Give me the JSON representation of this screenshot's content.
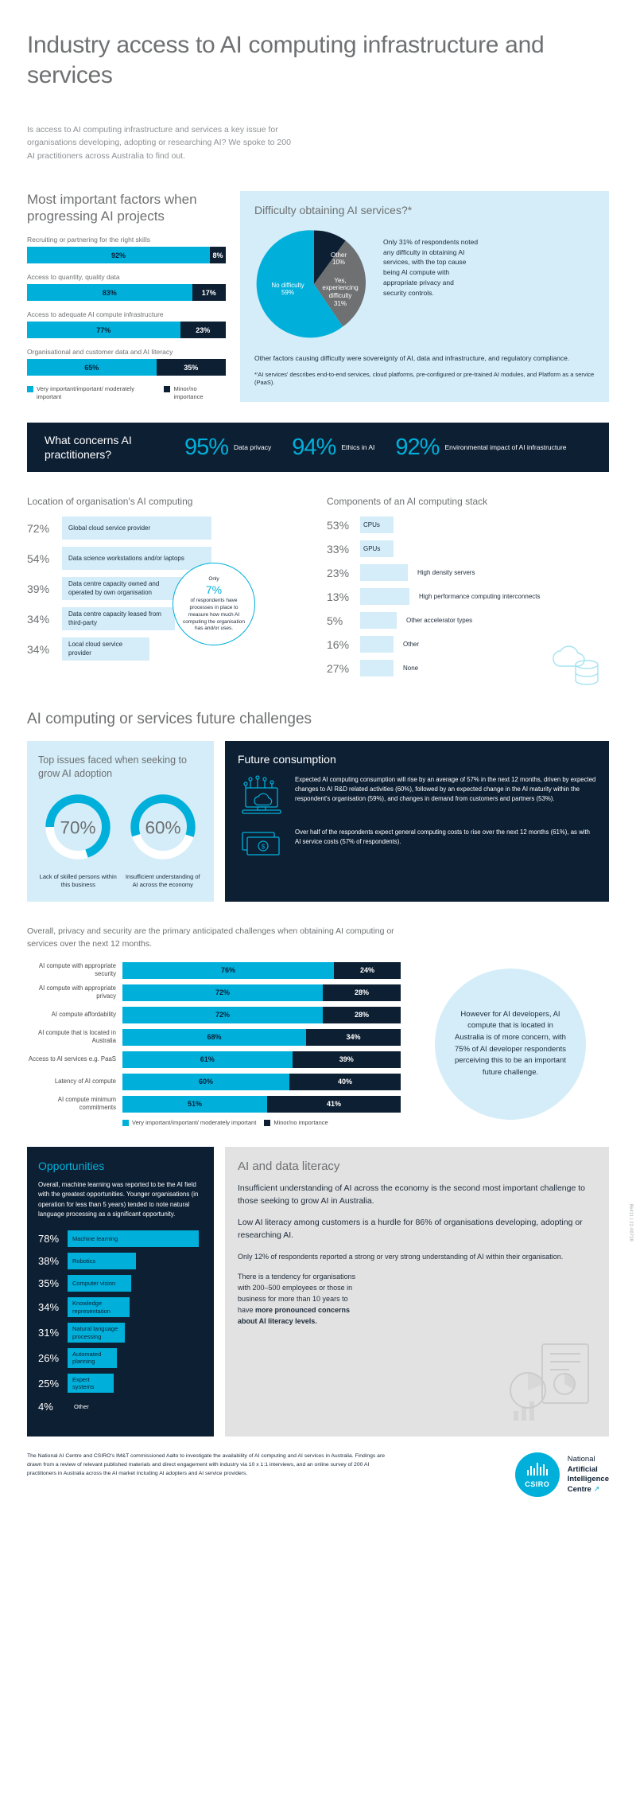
{
  "header": {
    "title": "Industry access to AI computing infrastructure and services",
    "intro": "Is access to AI computing infrastructure and services a key issue for organisations developing, adopting or researching AI? We spoke to 200 AI practitioners across Australia to find out."
  },
  "factors": {
    "heading": "Most important factors when progressing AI projects",
    "legend": {
      "primary": "Very important/important/ moderately important",
      "secondary": "Minor/no importance"
    },
    "items": [
      {
        "label": "Recruiting or partnering for the right skills",
        "primary": 92,
        "secondary": 8,
        "primary_text": "92%",
        "secondary_text": "8%"
      },
      {
        "label": "Access to quantity, quality data",
        "primary": 83,
        "secondary": 17,
        "primary_text": "83%",
        "secondary_text": "17%"
      },
      {
        "label": "Access to adequate AI compute infrastructure",
        "primary": 77,
        "secondary": 23,
        "primary_text": "77%",
        "secondary_text": "23%"
      },
      {
        "label": "Organisational and customer data and AI literacy",
        "primary": 65,
        "secondary": 35,
        "primary_text": "65%",
        "secondary_text": "35%"
      }
    ]
  },
  "difficulty": {
    "heading": "Difficulty obtaining AI services?*",
    "note": "Only 31% of respondents noted any difficulty in obtaining AI services, with the top cause being AI compute with appropriate privacy and security controls.",
    "footnote": "Other factors causing difficulty were sovereignty of AI, data and infrastructure, and regulatory compliance.",
    "asterisk": "*'AI services' describes end-to-end services, cloud platforms, pre-configured or pre-trained AI modules, and Platform as a service (PaaS).",
    "slices": [
      {
        "label": "No difficulty",
        "value": 59,
        "value_text": "59%",
        "color": "#00b0da"
      },
      {
        "label": "Other",
        "value": 10,
        "value_text": "10%",
        "color": "#0d1f33"
      },
      {
        "label": "Yes, experiencing difficulty",
        "value": 31,
        "value_text": "31%",
        "color": "#6e7072"
      }
    ]
  },
  "concerns": {
    "question": "What concerns AI practitioners?",
    "stats": [
      {
        "value": "95%",
        "caption": "Data privacy"
      },
      {
        "value": "94%",
        "caption": "Ethics in AI"
      },
      {
        "value": "92%",
        "caption": "Environmental impact of AI infrastructure"
      }
    ]
  },
  "location": {
    "heading": "Location of organisation's AI computing",
    "items": [
      {
        "pct": "72%",
        "value": 72,
        "label": "Global cloud service provider"
      },
      {
        "pct": "54%",
        "value": 54,
        "label": "Data science workstations and/or laptops"
      },
      {
        "pct": "39%",
        "value": 39,
        "label": "Data centre capacity owned and operated by own organisation"
      },
      {
        "pct": "34%",
        "value": 34,
        "label": "Data centre capacity leased from third-party"
      },
      {
        "pct": "34%",
        "value": 34,
        "label": "Local cloud service provider"
      }
    ],
    "callout": {
      "pre": "Only",
      "big": "7%",
      "post": "of respondents have processes in place to measure how much AI computing the organisation has and/or uses."
    }
  },
  "stack": {
    "heading": "Components of an AI computing stack",
    "items": [
      {
        "pct": "53%",
        "value": 53,
        "label": "CPUs"
      },
      {
        "pct": "33%",
        "value": 33,
        "label": "GPUs"
      },
      {
        "pct": "23%",
        "value": 23,
        "label": "High density servers"
      },
      {
        "pct": "13%",
        "value": 13,
        "label": "High performance computing interconnects"
      },
      {
        "pct": "5%",
        "value": 5,
        "label": "Other accelerator types"
      },
      {
        "pct": "16%",
        "value": 16,
        "label": "Other"
      },
      {
        "pct": "27%",
        "value": 27,
        "label": "None"
      }
    ]
  },
  "future_section": {
    "heading": "AI computing or services future challenges",
    "top_issues": {
      "heading": "Top issues faced when seeking to grow AI adoption",
      "donuts": [
        {
          "value": 70,
          "value_text": "70%",
          "caption": "Lack of skilled persons within this business"
        },
        {
          "value": 60,
          "value_text": "60%",
          "caption": "Insufficient understanding of AI across the economy"
        }
      ]
    },
    "consumption": {
      "heading": "Future consumption",
      "blocks": [
        {
          "icon": "cloud-laptop-icon",
          "text": "Expected AI computing consumption will rise by an average of 57% in the next 12 months, driven by expected changes to AI R&D related activities (60%), followed by an expected change in the AI maturity within the respondent's organisation (59%), and changes in demand from customers and partners (53%)."
        },
        {
          "icon": "money-icon",
          "text": "Over half of the respondents expect general computing costs to rise over the next 12 months (61%), as with AI service costs (57% of respondents)."
        }
      ]
    }
  },
  "privacy": {
    "lead": "Overall, privacy and security are the primary anticipated challenges when obtaining AI computing or services over the next 12 months.",
    "legend": {
      "primary": "Very important/important/ moderately important",
      "secondary": "Minor/no importance"
    },
    "items": [
      {
        "label": "AI compute with appropriate security",
        "primary": 76,
        "secondary": 24,
        "primary_text": "76%",
        "secondary_text": "24%"
      },
      {
        "label": "AI compute with appropriate privacy",
        "primary": 72,
        "secondary": 28,
        "primary_text": "72%",
        "secondary_text": "28%"
      },
      {
        "label": "AI compute affordability",
        "primary": 72,
        "secondary": 28,
        "primary_text": "72%",
        "secondary_text": "28%"
      },
      {
        "label": "AI compute that is located in Australia",
        "primary": 68,
        "secondary": 34,
        "primary_text": "68%",
        "secondary_text": "34%"
      },
      {
        "label": "Access to AI services e.g. PaaS",
        "primary": 61,
        "secondary": 39,
        "primary_text": "61%",
        "secondary_text": "39%"
      },
      {
        "label": "Latency of AI compute",
        "primary": 60,
        "secondary": 40,
        "primary_text": "60%",
        "secondary_text": "40%"
      },
      {
        "label": "AI compute minimum commitments",
        "primary": 51,
        "secondary": 41,
        "primary_text": "51%",
        "secondary_text": "41%"
      }
    ],
    "callout": "However for AI developers, AI compute that is located in Australia is of more concern, with 75% of AI developer respondents perceiving this to be an important future challenge."
  },
  "opportunities": {
    "heading": "Opportunities",
    "intro": "Overall, machine learning was reported to be the AI field with the greatest opportunities. Younger organisations (in operation for less than 5 years) tended to note natural language processing as a significant opportunity.",
    "items": [
      {
        "pct": "78%",
        "value": 78,
        "label": "Machine learning"
      },
      {
        "pct": "38%",
        "value": 38,
        "label": "Robotics"
      },
      {
        "pct": "35%",
        "value": 35,
        "label": "Computer vision"
      },
      {
        "pct": "34%",
        "value": 34,
        "label": "Knowledge representation"
      },
      {
        "pct": "31%",
        "value": 31,
        "label": "Natural language processing"
      },
      {
        "pct": "26%",
        "value": 26,
        "label": "Automated planning"
      },
      {
        "pct": "25%",
        "value": 25,
        "label": "Expert systems"
      },
      {
        "pct": "4%",
        "value": 4,
        "label": "Other"
      }
    ]
  },
  "literacy": {
    "heading": "AI and data literacy",
    "p1": "Insufficient understanding of AI across the economy is the second most important challenge to those seeking to grow AI in Australia.",
    "p2": "Low AI literacy among customers is a hurdle for 86% of organisations developing, adopting or researching AI.",
    "p3": "Only 12% of respondents reported a strong or very strong understanding of AI within their organisation.",
    "p4_a": "There is a tendency for organisations with 200–500 employees or those in business for more than 10 years to have ",
    "p4_b": "more pronounced concerns about AI literacy levels."
  },
  "footer": {
    "text": "The National AI Centre and CSIRO's IM&T commissioned Aalto to investigate the availability of AI computing and AI services in Australia. Findings are drawn from a review of relevant published materials and direct engagement with industry via 10 x 1:1 interviews, and an online survey of 200 AI practitioners in Australia across the AI market including AI adopters and AI service providers.",
    "logo_text": "CSIRO",
    "brand_line1": "National",
    "brand_line2": "Artificial",
    "brand_line3": "Intelligence",
    "brand_line4": "Centre",
    "side_code": "86411 | 22-00728"
  },
  "chart_data": [
    {
      "type": "bar",
      "title": "Most important factors when progressing AI projects",
      "categories": [
        "Recruiting or partnering for the right skills",
        "Access to quantity, quality data",
        "Access to adequate AI compute infrastructure",
        "Organisational and customer data and AI literacy"
      ],
      "series": [
        {
          "name": "Very important/important/moderately important",
          "values": [
            92,
            83,
            77,
            65
          ],
          "color": "#00b0da"
        },
        {
          "name": "Minor/no importance",
          "values": [
            8,
            17,
            23,
            35
          ],
          "color": "#0d1f33"
        }
      ],
      "xlabel": "",
      "ylabel": "",
      "ylim": [
        0,
        100
      ],
      "stacked": true,
      "orientation": "horizontal"
    },
    {
      "type": "pie",
      "title": "Difficulty obtaining AI services?*",
      "categories": [
        "No difficulty",
        "Other",
        "Yes, experiencing difficulty"
      ],
      "values": [
        59,
        10,
        31
      ],
      "colors": [
        "#00b0da",
        "#0d1f33",
        "#6e7072"
      ]
    },
    {
      "type": "bar",
      "title": "Location of organisation's AI computing",
      "categories": [
        "Global cloud service provider",
        "Data science workstations and/or laptops",
        "Data centre capacity owned and operated by own organisation",
        "Data centre capacity leased from third-party",
        "Local cloud service provider"
      ],
      "values": [
        72,
        54,
        39,
        34,
        34
      ],
      "ylim": [
        0,
        100
      ],
      "orientation": "horizontal"
    },
    {
      "type": "bar",
      "title": "Components of an AI computing stack",
      "categories": [
        "CPUs",
        "GPUs",
        "High density servers",
        "High performance computing interconnects",
        "Other accelerator types",
        "Other",
        "None"
      ],
      "values": [
        53,
        33,
        23,
        13,
        5,
        16,
        27
      ],
      "ylim": [
        0,
        100
      ],
      "orientation": "horizontal"
    },
    {
      "type": "pie",
      "title": "Top issues faced when seeking to grow AI adoption",
      "categories": [
        "Lack of skilled persons within this business",
        "Insufficient understanding of AI across the economy"
      ],
      "values": [
        70,
        60
      ],
      "note": "Two separate donut gauges"
    },
    {
      "type": "bar",
      "title": "Anticipated challenges obtaining AI computing or services over the next 12 months",
      "categories": [
        "AI compute with appropriate security",
        "AI compute with appropriate privacy",
        "AI compute affordability",
        "AI compute that is located in Australia",
        "Access to AI services e.g. PaaS",
        "Latency of AI compute",
        "AI compute minimum commitments"
      ],
      "series": [
        {
          "name": "Very important/important/moderately important",
          "values": [
            76,
            72,
            72,
            68,
            61,
            60,
            51
          ],
          "color": "#00b0da"
        },
        {
          "name": "Minor/no importance",
          "values": [
            24,
            28,
            28,
            34,
            39,
            40,
            41
          ],
          "color": "#0d1f33"
        }
      ],
      "ylim": [
        0,
        100
      ],
      "stacked": true,
      "orientation": "horizontal"
    },
    {
      "type": "bar",
      "title": "Opportunities",
      "categories": [
        "Machine learning",
        "Robotics",
        "Computer vision",
        "Knowledge representation",
        "Natural language processing",
        "Automated planning",
        "Expert systems",
        "Other"
      ],
      "values": [
        78,
        38,
        35,
        34,
        31,
        26,
        25,
        4
      ],
      "ylim": [
        0,
        100
      ],
      "orientation": "horizontal"
    }
  ]
}
